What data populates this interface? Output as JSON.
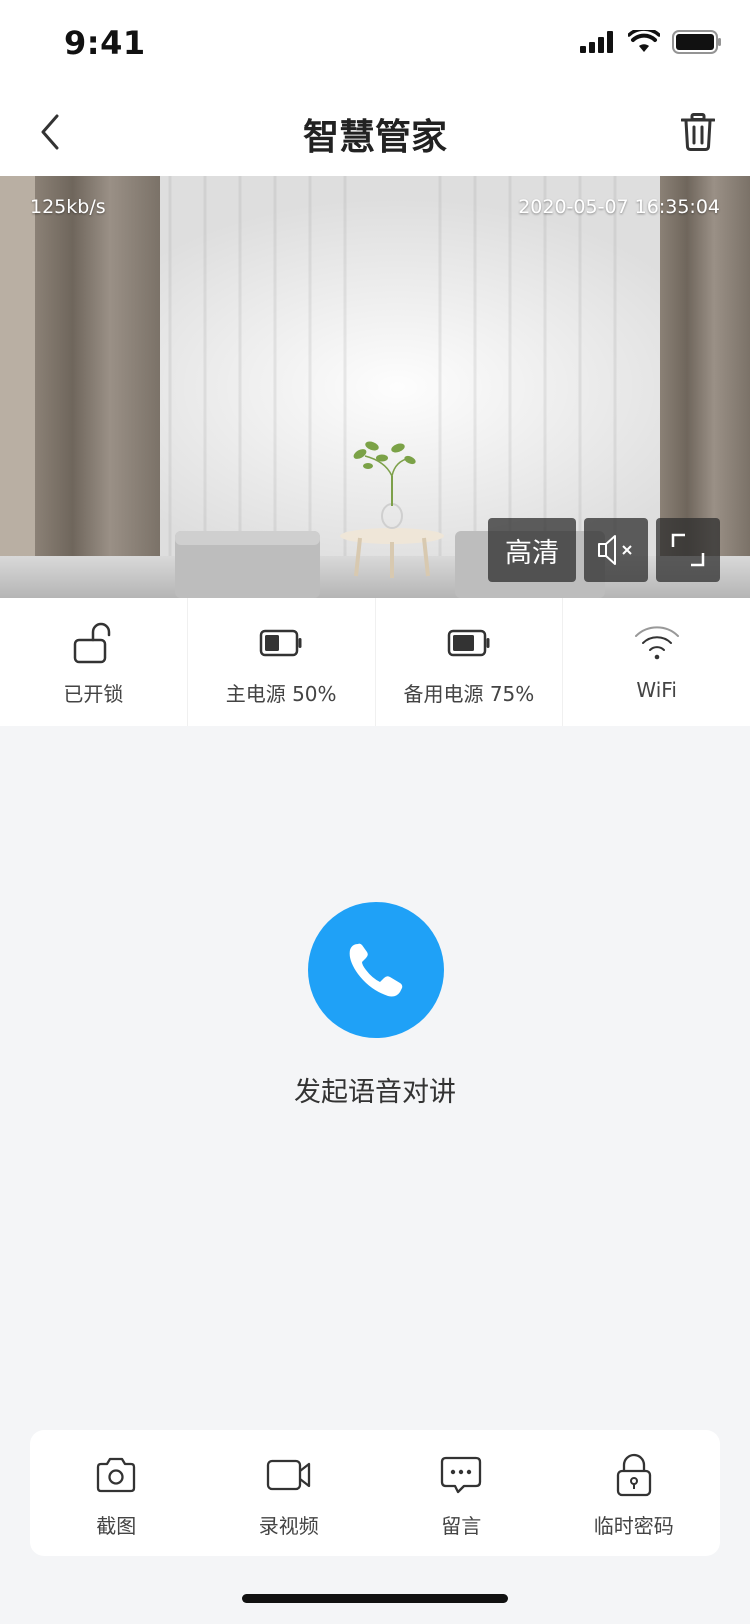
{
  "status_bar": {
    "time": "9:41"
  },
  "nav": {
    "title": "智慧管家"
  },
  "video": {
    "bitrate": "125kb/s",
    "timestamp": "2020-05-07 16:35:04",
    "quality_label": "高清"
  },
  "device_status": [
    {
      "label": "已开锁",
      "icon": "unlock-icon"
    },
    {
      "label": "主电源 50%",
      "icon": "battery-icon",
      "level": 0.5
    },
    {
      "label": "备用电源 75%",
      "icon": "battery-icon",
      "level": 0.75
    },
    {
      "label": "WiFi",
      "icon": "wifi-icon"
    }
  ],
  "call": {
    "label": "发起语音对讲",
    "color": "#1fa1f7"
  },
  "toolbar": [
    {
      "label": "截图",
      "icon": "camera-icon"
    },
    {
      "label": "录视频",
      "icon": "video-camera-icon"
    },
    {
      "label": "留言",
      "icon": "message-icon"
    },
    {
      "label": "临时密码",
      "icon": "lock-icon"
    }
  ]
}
